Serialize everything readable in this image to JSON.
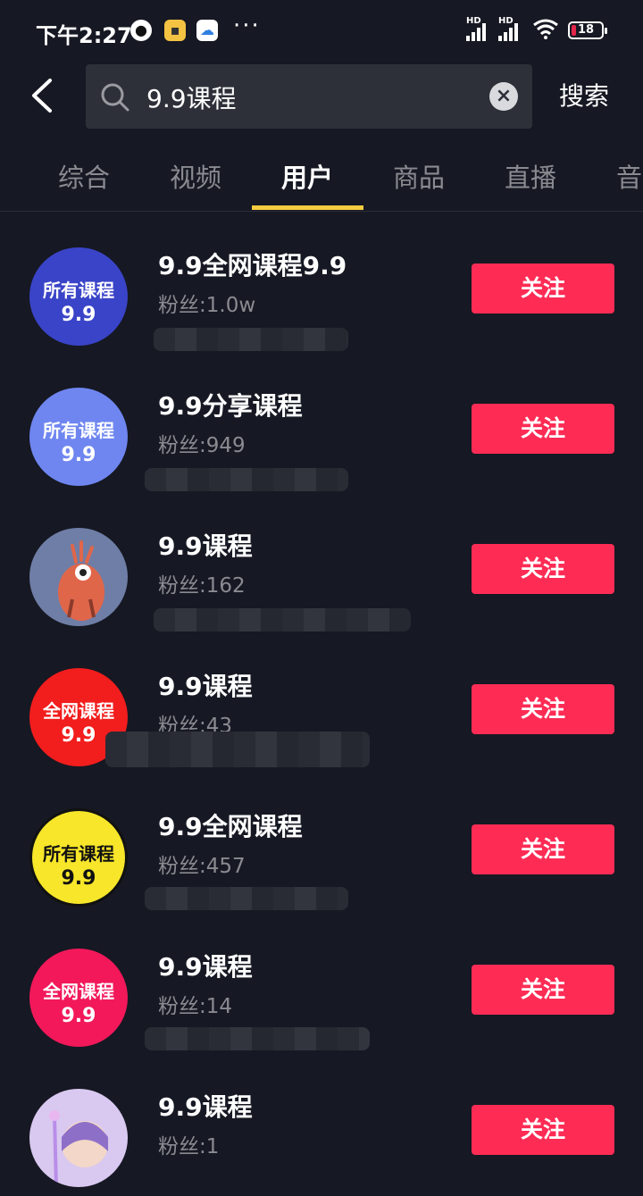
{
  "status_bar": {
    "time": "下午2:27",
    "hd1": "HD",
    "hd2": "HD",
    "battery": "18"
  },
  "search": {
    "back_icon": "back-arrow-icon",
    "query": "9.9课程",
    "search_button": "搜索"
  },
  "tabs": [
    {
      "label": "综合"
    },
    {
      "label": "视频"
    },
    {
      "label": "用户"
    },
    {
      "label": "商品"
    },
    {
      "label": "直播"
    },
    {
      "label": "音"
    }
  ],
  "active_tab": "用户",
  "users": [
    {
      "name": "9.9全网课程9.9",
      "fans": "粉丝:1.0w",
      "avatar_line1": "所有课程",
      "avatar_line2": "9.9",
      "avatar_bg": "#3a44c8",
      "avatar_fg": "#ffffff",
      "follow": "关注"
    },
    {
      "name": "9.9分享课程",
      "fans": "粉丝:949",
      "avatar_line1": "所有课程",
      "avatar_line2": "9.9",
      "avatar_bg": "#6f86f0",
      "avatar_fg": "#ffffff",
      "follow": "关注"
    },
    {
      "name": "9.9课程",
      "fans": "粉丝:162",
      "avatar_line1": "",
      "avatar_line2": "",
      "avatar_bg": "#6f7ea6",
      "avatar_fg": "#ffffff",
      "follow": "关注"
    },
    {
      "name": "9.9课程",
      "fans": "粉丝:43",
      "avatar_line1": "全网课程",
      "avatar_line2": "9.9",
      "avatar_bg": "#f21d1d",
      "avatar_fg": "#ffffff",
      "follow": "关注"
    },
    {
      "name": "9.9全网课程",
      "fans": "粉丝:457",
      "avatar_line1": "所有课程",
      "avatar_line2": "9.9",
      "avatar_bg": "#f7e629",
      "avatar_fg": "#111111",
      "follow": "关注"
    },
    {
      "name": "9.9课程",
      "fans": "粉丝:14",
      "avatar_line1": "全网课程",
      "avatar_line2": "9.9",
      "avatar_bg": "#f2185a",
      "avatar_fg": "#ffffff",
      "follow": "关注"
    },
    {
      "name": "9.9课程",
      "fans": "粉丝:1",
      "avatar_line1": "",
      "avatar_line2": "",
      "avatar_bg": "#d9c8f0",
      "avatar_fg": "#ffffff",
      "follow": "关注"
    }
  ],
  "colors": {
    "background": "#161823",
    "follow_button": "#fe2c55",
    "tab_indicator": "#f7cb3f",
    "secondary_text": "#8a8b91"
  }
}
